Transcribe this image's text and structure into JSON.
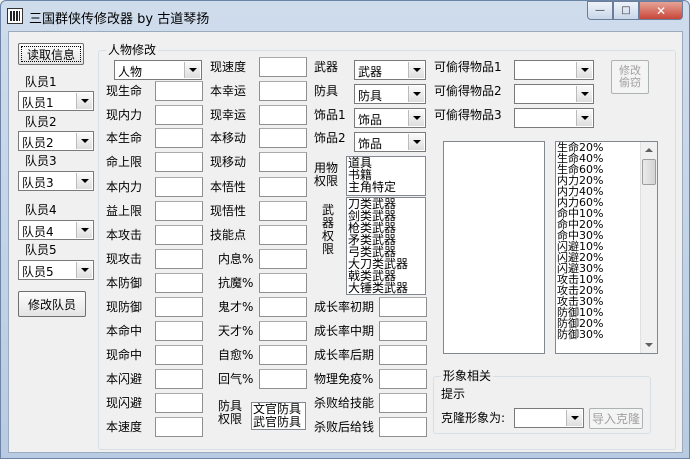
{
  "window": {
    "title": "三国群侠传修改器 by 古道琴扬",
    "min_glyph": "—",
    "max_glyph": "□",
    "close_glyph": "✕"
  },
  "left": {
    "read_button": "读取信息",
    "members": [
      {
        "label": "队员1",
        "value": "队员1"
      },
      {
        "label": "队员2",
        "value": "队员2"
      },
      {
        "label": "队员3",
        "value": "队员3"
      },
      {
        "label": "队员4",
        "value": "队员4"
      },
      {
        "label": "队员5",
        "value": "队员5"
      }
    ],
    "modify_button": "修改队员"
  },
  "char": {
    "group_title": "人物修改",
    "type_select": "人物",
    "col1": [
      "现生命",
      "现内力",
      "本生命",
      "命上限",
      "本内力",
      "益上限",
      "本攻击",
      "现攻击",
      "本防御",
      "现防御",
      "本命中",
      "现命中",
      "本闪避",
      "现闪避",
      "本速度"
    ],
    "col2": [
      "现速度",
      "本幸运",
      "现幸运",
      "本移动",
      "现移动",
      "本悟性",
      "现悟性",
      "技能点",
      "内息%",
      "抗魔%",
      "鬼才%",
      "天才%",
      "自愈%",
      "回气%"
    ],
    "equip_labels": [
      "武器",
      "防具",
      "饰品1",
      "饰品2"
    ],
    "equip_values": [
      "武器",
      "防具",
      "饰品",
      "饰品"
    ],
    "use_perm_label": "用物权限",
    "use_perm_items": [
      "道具",
      "书籍",
      "主角特定"
    ],
    "weapon_perm_label": "武器权限",
    "weapon_perm_items": [
      "刀类武器",
      "剑类武器",
      "枪类武器",
      "矛类武器",
      "弓类武器",
      "大刀类武器",
      "戟类武器",
      "大锤类武器"
    ],
    "growth_labels": [
      "成长率初期",
      "成长率中期",
      "成长率后期",
      "物理免疫%",
      "杀败给技能",
      "杀败后给钱"
    ],
    "armor_perm_label": "防具权限",
    "armor_perm_items": [
      "文官防具",
      "武官防具"
    ],
    "steal_labels": [
      "可偷得物品1",
      "可偷得物品2",
      "可偷得物品3"
    ],
    "steal_button": "修改偷窃",
    "skill_list": [
      "生命20%",
      "生命40%",
      "生命60%",
      "内力20%",
      "内力40%",
      "内力60%",
      "命中10%",
      "命中20%",
      "命中30%",
      "闪避10%",
      "闪避20%",
      "闪避30%",
      "攻击10%",
      "攻击20%",
      "攻击30%",
      "防御10%",
      "防御20%",
      "防御30%"
    ]
  },
  "image": {
    "group_title": "形象相关",
    "hint": "提示",
    "clone_label": "克隆形象为:",
    "import_button": "导入克隆"
  }
}
